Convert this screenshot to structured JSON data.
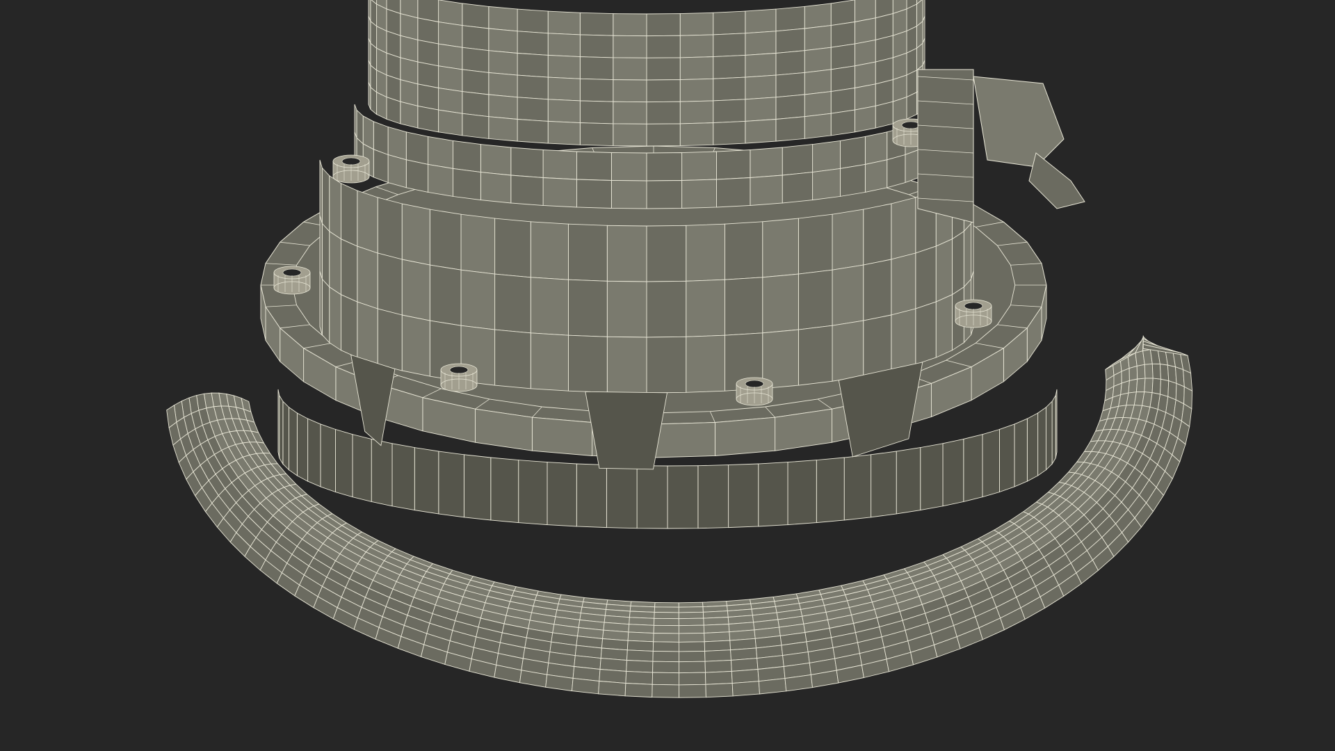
{
  "scene": {
    "background": "#262626",
    "surface_color": "#6b6b60",
    "surface_light": "#7a7a6e",
    "surface_dark": "#55554b",
    "wire_color": "#e8e6d6",
    "bolt_color": "#a29f8f",
    "hole_color": "#262626",
    "bolt_count": 6,
    "ring_segments": 40,
    "handle_segments": 60,
    "handle_rings": 11,
    "column_segments": 26,
    "icons": [
      "viewport-3d-icon"
    ]
  }
}
